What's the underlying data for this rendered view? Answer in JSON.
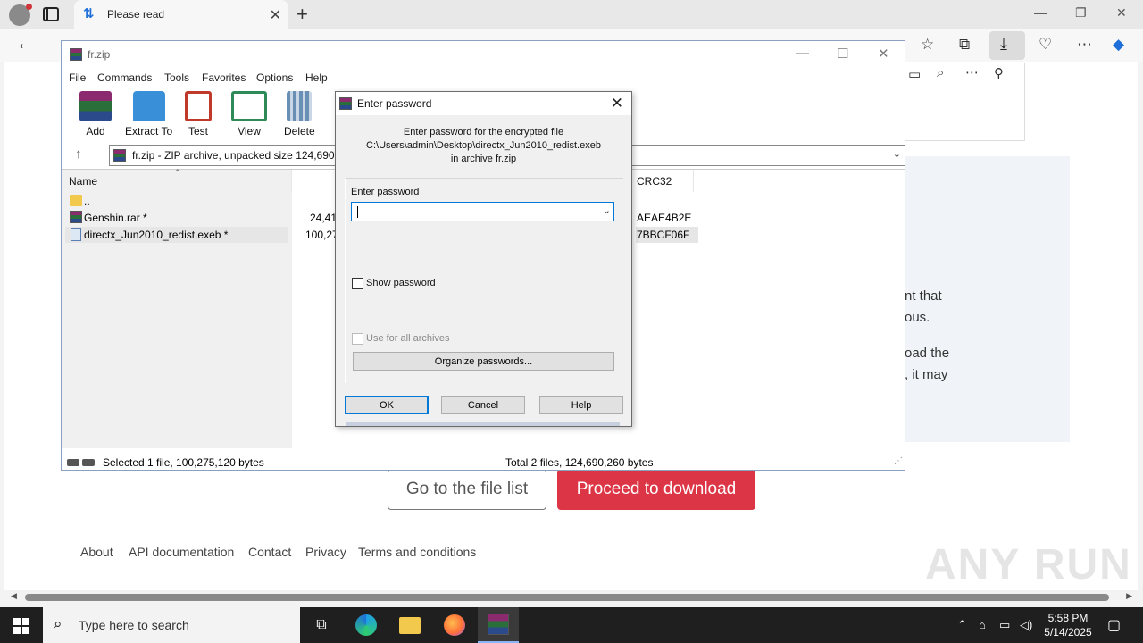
{
  "browser": {
    "tab_title": "Please read",
    "new_tab": "+",
    "close_tab": "✕",
    "minimize": "—",
    "restore": "❐",
    "close": "✕"
  },
  "webpage": {
    "text_lines": [
      "nt that",
      "ous.",
      "oad the",
      ", it may"
    ],
    "file_list_button": "Go to the file list",
    "download_button": "Proceed to download",
    "footer_links": [
      "About",
      "API documentation",
      "Contact",
      "Privacy",
      "Terms and conditions"
    ],
    "watermark": "ANY RUN"
  },
  "winrar": {
    "title": "fr.zip",
    "menu": [
      "File",
      "Commands",
      "Tools",
      "Favorites",
      "Options",
      "Help"
    ],
    "toolbar": [
      {
        "label": "Add",
        "icon": "add-archive-icon",
        "color": "#b5342f"
      },
      {
        "label": "Extract To",
        "icon": "extract-folder-icon",
        "color": "#3a8fd9"
      },
      {
        "label": "Test",
        "icon": "test-clipboard-icon",
        "color": "#c0392b"
      },
      {
        "label": "View",
        "icon": "view-book-icon",
        "color": "#2e8b57"
      },
      {
        "label": "Delete",
        "icon": "delete-bin-icon",
        "color": "#6a8fb5"
      }
    ],
    "address": "fr.zip - ZIP archive, unpacked size 124,690,2",
    "columns": {
      "name": "Name",
      "crc": "CRC32"
    },
    "files": [
      {
        "name": "..",
        "size": "",
        "crc": "",
        "type": "folder"
      },
      {
        "name": "Genshin.rar *",
        "size": "24,41",
        "crc": "AEAE4B2E",
        "type": "rar"
      },
      {
        "name": "directx_Jun2010_redist.exeb *",
        "size": "100,27",
        "crc": "7BBCF06F",
        "type": "file"
      }
    ],
    "status_left": "Selected 1 file, 100,275,120 bytes",
    "status_right": "Total 2 files, 124,690,260 bytes"
  },
  "dialog": {
    "title": "Enter password",
    "info_line1": "Enter password for the encrypted file",
    "info_line2": "C:\\Users\\admin\\Desktop\\directx_Jun2010_redist.exeb",
    "info_line3": "in archive fr.zip",
    "password_label": "Enter password",
    "password_value": "",
    "show_password": "Show password",
    "use_all": "Use for all archives",
    "organize": "Organize passwords...",
    "ok": "OK",
    "cancel": "Cancel",
    "help": "Help"
  },
  "taskbar": {
    "search_placeholder": "Type here to search",
    "time": "5:58 PM",
    "date": "5/14/2025"
  }
}
